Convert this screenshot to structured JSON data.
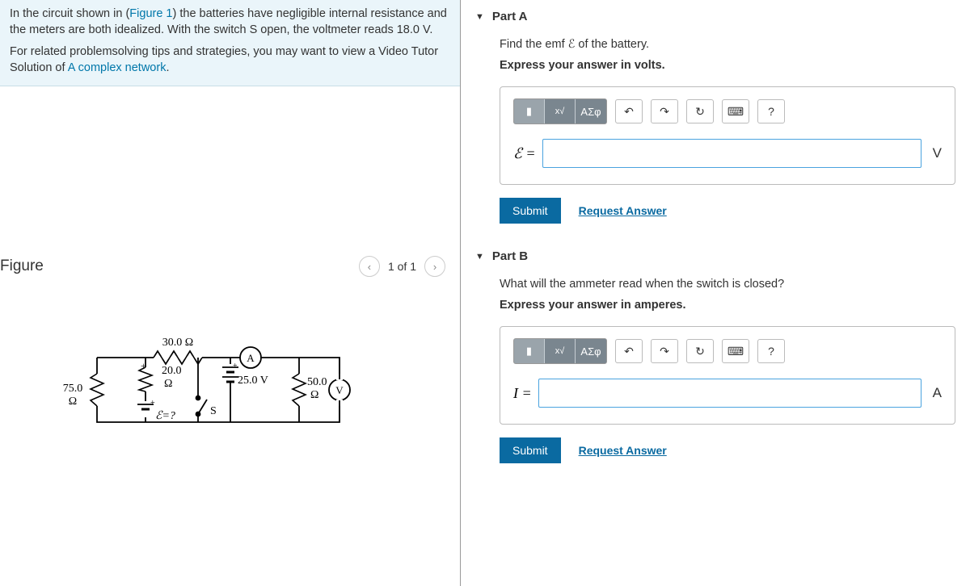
{
  "problem": {
    "intro_pre": "In the circuit shown in (",
    "fig_link": "Figure 1",
    "intro_post": ") the batteries have negligible internal resistance and the meters are both idealized. With the switch S open, the voltmeter reads 18.0 V.",
    "tips_pre": "For related problemsolving tips and strategies, you may want to view a Video Tutor Solution of ",
    "tips_link": "A complex network",
    "tips_post": "."
  },
  "figure": {
    "title": "Figure",
    "pager": "1 of 1",
    "labels": {
      "r75": "75.0 Ω",
      "r20": "20.0 Ω",
      "r30": "30.0 Ω",
      "emf": "ℰ=?",
      "switch": "S",
      "v25": "25.0 V",
      "ammeter": "A",
      "r50": "50.0 Ω",
      "voltmeter": "V"
    }
  },
  "partA": {
    "title": "Part A",
    "question": "Find the emf ℰ of the battery.",
    "instruction": "Express your answer in volts.",
    "var": "ℰ = ",
    "unit": "V",
    "submit": "Submit",
    "request": "Request Answer",
    "greek": "ΑΣφ"
  },
  "partB": {
    "title": "Part B",
    "question": "What will the ammeter read when the switch is closed?",
    "instruction": "Express your answer in amperes.",
    "var": "I = ",
    "unit": "A",
    "submit": "Submit",
    "request": "Request Answer",
    "greek": "ΑΣφ"
  }
}
